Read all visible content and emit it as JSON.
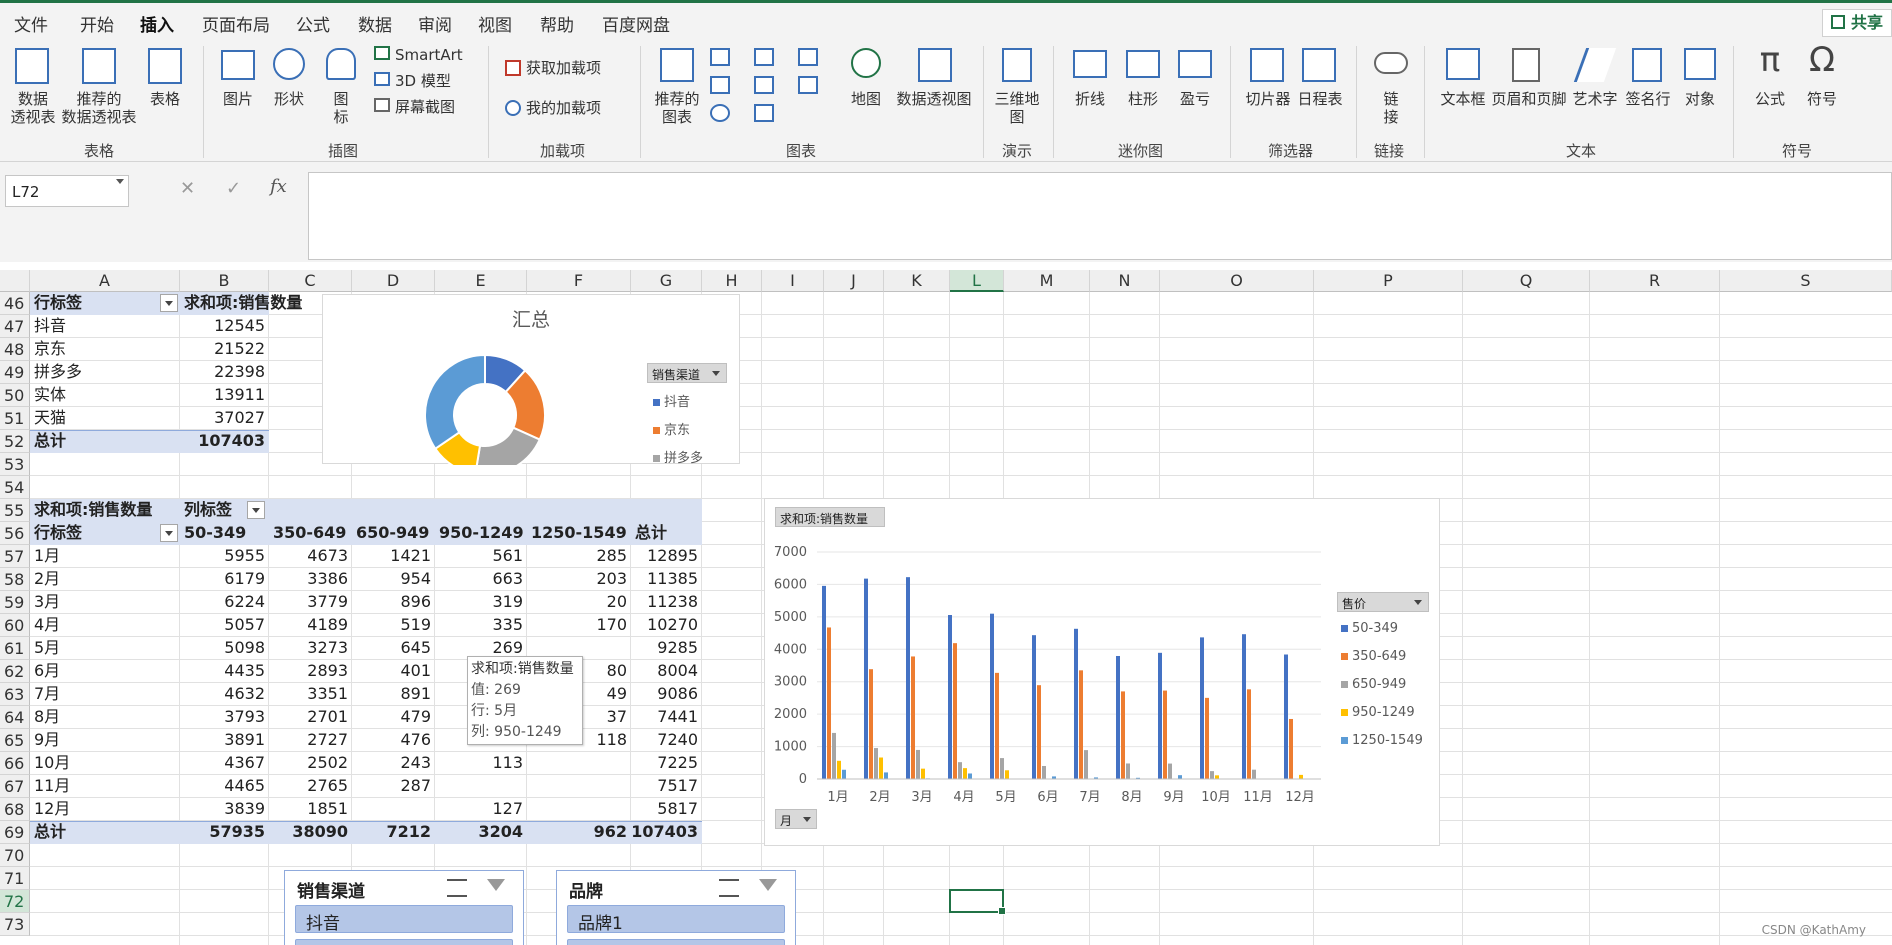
{
  "menu": [
    "文件",
    "开始",
    "插入",
    "页面布局",
    "公式",
    "数据",
    "审阅",
    "视图",
    "帮助",
    "百度网盘"
  ],
  "menu_active": "插入",
  "share_label": "共享",
  "ribbon": {
    "groups": [
      "表格",
      "插图",
      "加载项",
      "图表",
      "演示",
      "迷你图",
      "筛选器",
      "链接",
      "文本",
      "符号"
    ],
    "pivot_table": [
      "数据",
      "透视表"
    ],
    "recommended_pivot": [
      "推荐的",
      "数据透视表"
    ],
    "table": "表格",
    "picture": "图片",
    "shapes": "形状",
    "icons": [
      "图",
      "标"
    ],
    "smartart": "SmartArt",
    "model3d": "3D 模型",
    "screenshot": "屏幕截图",
    "get_addins": "获取加载项",
    "my_addins": "我的加载项",
    "rec_charts": [
      "推荐的",
      "图表"
    ],
    "maps": "地图",
    "pivot_chart": "数据透视图",
    "map3d": [
      "三维地",
      "图"
    ],
    "spark_line": "折线",
    "spark_column": "柱形",
    "spark_winloss": "盈亏",
    "slicer": "切片器",
    "timeline": "日程表",
    "link": [
      "链",
      "接"
    ],
    "textbox": "文本框",
    "header_footer": "页眉和页脚",
    "wordart": "艺术字",
    "signature": "签名行",
    "object": "对象",
    "equation": "公式",
    "symbol": "符号"
  },
  "namebox": "L72",
  "fx": "fx",
  "columns": [
    "A",
    "B",
    "C",
    "D",
    "E",
    "F",
    "G",
    "H",
    "I",
    "J",
    "K",
    "L",
    "M",
    "N",
    "O",
    "P",
    "Q",
    "R",
    "S"
  ],
  "selected_column": "L",
  "rows": [
    "46",
    "47",
    "48",
    "49",
    "50",
    "51",
    "52",
    "53",
    "54",
    "55",
    "56",
    "57",
    "58",
    "59",
    "60",
    "61",
    "62",
    "63",
    "64",
    "65",
    "66",
    "67",
    "68",
    "69",
    "70",
    "71",
    "72",
    "73"
  ],
  "selected_row": "72",
  "pivot1": {
    "h1": "行标签",
    "h2": "求和项:销售数量",
    "rows": [
      [
        "抖音",
        "12545"
      ],
      [
        "京东",
        "21522"
      ],
      [
        "拼多多",
        "22398"
      ],
      [
        "实体",
        "13911"
      ],
      [
        "天猫",
        "37027"
      ]
    ],
    "total": [
      "总计",
      "107403"
    ]
  },
  "pivot2": {
    "title": "求和项:销售数量",
    "col_label": "列标签",
    "row_label": "行标签",
    "headers": [
      "50-349",
      "350-649",
      "650-949",
      "950-1249",
      "1250-1549",
      "总计"
    ],
    "rows": [
      [
        "1月",
        "5955",
        "4673",
        "1421",
        "561",
        "285",
        "12895"
      ],
      [
        "2月",
        "6179",
        "3386",
        "954",
        "663",
        "203",
        "11385"
      ],
      [
        "3月",
        "6224",
        "3779",
        "896",
        "319",
        "20",
        "11238"
      ],
      [
        "4月",
        "5057",
        "4189",
        "519",
        "335",
        "170",
        "10270"
      ],
      [
        "5月",
        "5098",
        "3273",
        "645",
        "269",
        "",
        "9285"
      ],
      [
        "6月",
        "4435",
        "2893",
        "401",
        "",
        "80",
        "8004"
      ],
      [
        "7月",
        "4632",
        "3351",
        "891",
        "",
        "49",
        "9086"
      ],
      [
        "8月",
        "3793",
        "2701",
        "479",
        "",
        "37",
        "7441"
      ],
      [
        "9月",
        "3891",
        "2727",
        "476",
        "",
        "118",
        "7240"
      ],
      [
        "10月",
        "4367",
        "2502",
        "243",
        "113",
        "",
        "7225"
      ],
      [
        "11月",
        "4465",
        "2765",
        "287",
        "",
        "",
        "7517"
      ],
      [
        "12月",
        "3839",
        "1851",
        "",
        "127",
        "",
        "5817"
      ]
    ],
    "total": [
      "总计",
      "57935",
      "38090",
      "7212",
      "3204",
      "962",
      "107403"
    ]
  },
  "tooltip": {
    "title": "求和项:销售数量",
    "value": "值: 269",
    "row": "行: 5月",
    "col": "列: 950-1249"
  },
  "chart_data": [
    {
      "type": "pie",
      "title": "汇总",
      "legend_title": "销售渠道",
      "categories": [
        "抖音",
        "京东",
        "拼多多",
        "实体",
        "天猫"
      ],
      "values": [
        12545,
        21522,
        22398,
        13911,
        37027
      ],
      "legend_visible": [
        "抖音",
        "京东",
        "拼多多"
      ],
      "colors": [
        "#4472c4",
        "#ed7d31",
        "#a5a5a5",
        "#ffc000",
        "#5b9bd5"
      ]
    },
    {
      "type": "bar",
      "field_button": "求和项:销售数量",
      "legend_title": "售价",
      "axis_button": "月",
      "categories": [
        "1月",
        "2月",
        "3月",
        "4月",
        "5月",
        "6月",
        "7月",
        "8月",
        "9月",
        "10月",
        "11月",
        "12月"
      ],
      "ylim": [
        0,
        7000
      ],
      "yticks": [
        "0",
        "1000",
        "2000",
        "3000",
        "4000",
        "5000",
        "6000",
        "7000"
      ],
      "series": [
        {
          "name": "50-349",
          "color": "#4472c4",
          "values": [
            5955,
            6179,
            6224,
            5057,
            5098,
            4435,
            4632,
            3793,
            3891,
            4367,
            4465,
            3839
          ]
        },
        {
          "name": "350-649",
          "color": "#ed7d31",
          "values": [
            4673,
            3386,
            3779,
            4189,
            3273,
            2893,
            3351,
            2701,
            2727,
            2502,
            2765,
            1851
          ]
        },
        {
          "name": "650-949",
          "color": "#a5a5a5",
          "values": [
            1421,
            954,
            896,
            519,
            645,
            401,
            891,
            479,
            476,
            243,
            287,
            0
          ]
        },
        {
          "name": "950-1249",
          "color": "#ffc000",
          "values": [
            561,
            663,
            319,
            335,
            269,
            0,
            0,
            0,
            0,
            113,
            0,
            127
          ]
        },
        {
          "name": "1250-1549",
          "color": "#5b9bd5",
          "values": [
            285,
            203,
            20,
            170,
            0,
            80,
            49,
            37,
            118,
            0,
            0,
            0
          ]
        }
      ]
    }
  ],
  "slicer1": {
    "title": "销售渠道",
    "item": "抖音"
  },
  "slicer2": {
    "title": "品牌",
    "item": "品牌1"
  },
  "watermark": "CSDN @KathAmy"
}
